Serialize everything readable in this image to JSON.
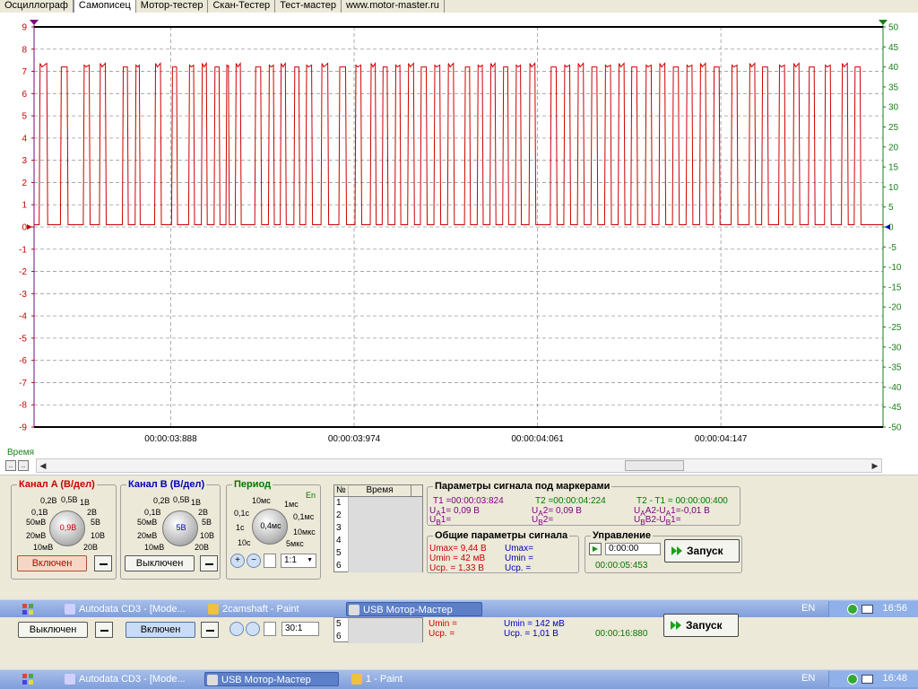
{
  "tabs": [
    "Осциллограф",
    "Самописец",
    "Мотор-тестер",
    "Скан-Тестер",
    "Тест-мастер",
    "www.motor-master.ru"
  ],
  "active_tab": 1,
  "colors": {
    "channel_a": "#cc0000",
    "channel_b": "#007700",
    "cursor_marker": "#800080"
  },
  "chart_data": {
    "type": "line",
    "title": "",
    "xlabel": "Время",
    "y_left": {
      "ticks": [
        9,
        8,
        7,
        6,
        5,
        4,
        3,
        2,
        1,
        0,
        -1,
        -2,
        -3,
        -4,
        -5,
        -6,
        -7,
        -8,
        -9
      ],
      "ylim": [
        -9,
        9
      ]
    },
    "y_right": {
      "ticks": [
        50,
        45,
        40,
        35,
        30,
        25,
        20,
        15,
        10,
        5,
        0,
        -5,
        -10,
        -15,
        -20,
        -25,
        -30,
        -35,
        -40,
        -45,
        -50
      ],
      "ylim": [
        -50,
        50
      ]
    },
    "x_tick_labels": [
      "00:00:03:888",
      "00:00:03:974",
      "00:00:04:061",
      "00:00:04:147"
    ],
    "grid": true,
    "series": [
      {
        "high_value": 7.2,
        "low_value": 0.1,
        "pulse_high_starts": [
          0.006,
          0.031,
          0.058,
          0.077,
          0.104,
          0.119,
          0.142,
          0.162,
          0.182,
          0.197,
          0.212,
          0.226,
          0.237,
          0.26,
          0.276,
          0.29,
          0.306,
          0.32,
          0.338,
          0.359,
          0.378,
          0.396,
          0.41,
          0.425,
          0.44,
          0.455,
          0.471,
          0.487,
          0.507,
          0.522,
          0.537,
          0.552,
          0.567,
          0.583,
          0.608,
          0.624,
          0.64,
          0.656,
          0.672,
          0.688,
          0.703,
          0.72,
          0.736,
          0.752,
          0.768,
          0.784,
          0.8,
          0.821,
          0.842,
          0.857,
          0.877,
          0.894,
          0.912,
          0.931,
          0.951,
          0.966
        ],
        "pulse_widths": [
          0.01,
          0.009,
          0.008,
          0.008,
          0.007,
          0.006,
          0.008,
          0.007,
          0.007,
          0.007,
          0.007,
          0.004,
          0.007,
          0.008,
          0.007,
          0.007,
          0.007,
          0.008,
          0.009,
          0.009,
          0.008,
          0.007,
          0.007,
          0.007,
          0.008,
          0.008,
          0.008,
          0.008,
          0.007,
          0.007,
          0.007,
          0.007,
          0.007,
          0.008,
          0.008,
          0.008,
          0.008,
          0.008,
          0.008,
          0.008,
          0.008,
          0.008,
          0.008,
          0.008,
          0.008,
          0.008,
          0.008,
          0.008,
          0.008,
          0.008,
          0.008,
          0.008,
          0.008,
          0.008,
          0.008,
          0.008
        ]
      }
    ]
  },
  "time_label": "Время",
  "channel_a": {
    "title": "Канал A (В/дел)",
    "scale_labels": [
      "0,2В",
      "0,5В",
      "1В",
      "0,1В",
      "2В",
      "50мВ",
      "5В",
      "20мВ",
      "10В",
      "10мВ",
      "20В"
    ],
    "knob_value": "0,9В",
    "toggle_label": "Включен"
  },
  "channel_b": {
    "title": "Канал B (В/дел)",
    "scale_labels": [
      "0,2В",
      "0,5В",
      "1В",
      "0,1В",
      "2В",
      "50мВ",
      "5В",
      "20мВ",
      "10В",
      "10мВ",
      "20В"
    ],
    "knob_value": "5В",
    "toggle_label": "Выключен"
  },
  "period": {
    "title": "Период",
    "en_label": "En",
    "scale_labels": [
      "10мс",
      "1мс",
      "0,1с",
      "0,1мс",
      "1с",
      "10мкс",
      "10с",
      "5мкс"
    ],
    "knob_value": "0,4мс",
    "ratio": "1:1"
  },
  "markers_table": {
    "headers": [
      "№",
      "Время"
    ],
    "rows": [
      "1",
      "2",
      "3",
      "4",
      "5",
      "6"
    ]
  },
  "marker_params": {
    "title": "Параметры сигнала под маркерами",
    "t1": "T1 =00:00:03:824",
    "t2": "T2 =00:00:04:224",
    "dt": "T2 - T1 = 00:00:00:400",
    "ua1": "U",
    "ua1_sub": "A",
    "ua1_val": "1= 0,09 В",
    "ua2_sub": "A",
    "ua2_val": "2= 0,09 В",
    "uadiff": "A2-U",
    "uadiff_sub": "A",
    "uadiff_val": "1=-0,01 В",
    "ub1_sub": "B",
    "ub1_val": "1=",
    "ub2_sub": "B",
    "ub2_val": "2=",
    "ubdiff": "B2-U",
    "ubdiff_sub": "B",
    "ubdiff_val": "1="
  },
  "general_params": {
    "title": "Общие параметры сигнала",
    "a": [
      "Umax= 9,44 В",
      "Umin = 42 мВ",
      "Uср. = 1,33 В"
    ],
    "b": [
      "Umax=",
      "Umin =",
      "Uср. ="
    ]
  },
  "control": {
    "title": "Управление",
    "time_value": "0:00:00",
    "elapsed": "00:00:05:453",
    "start_label": "Запуск"
  },
  "taskbar1": {
    "items": [
      "Autodata CD3 - [Mode...",
      "2camshaft - Paint",
      "USB Мотор-Мастер"
    ],
    "active": 2,
    "lang": "EN",
    "clock": "16:56"
  },
  "ghost": {
    "toggle_a": "Выключен",
    "toggle_b": "Включен",
    "ratio": "30:1",
    "rows": [
      "5",
      "6"
    ],
    "a": [
      "Umin =",
      "Uср. ="
    ],
    "b": [
      "Umin = 142 мВ",
      "Uср. = 1,01 В"
    ],
    "elapsed": "00:00:16:880",
    "start_label": "Запуск"
  },
  "taskbar2": {
    "items": [
      "Autodata CD3 - [Mode...",
      "USB Мотор-Мастер",
      "1 - Paint"
    ],
    "active": 1,
    "lang": "EN",
    "clock": "16:48"
  }
}
